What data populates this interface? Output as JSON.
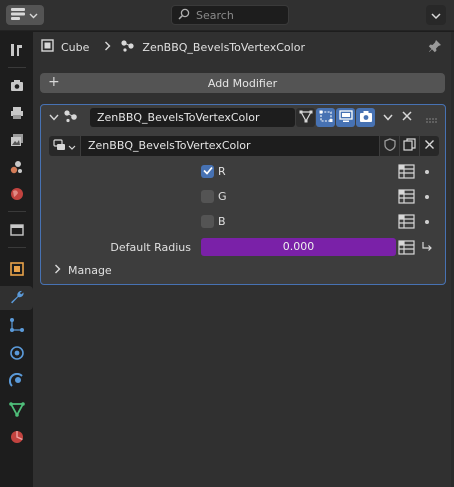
{
  "topbar": {
    "editor_icon": "properties-editor-icon",
    "search": {
      "placeholder": "Search"
    },
    "dropdown_icon": "chevron-down-icon"
  },
  "tabs": [
    {
      "name": "tool-tab",
      "icon": "tool-icon"
    },
    {
      "name": "render-tab",
      "icon": "camera-back-icon"
    },
    {
      "name": "output-tab",
      "icon": "printer-icon"
    },
    {
      "name": "view-layer-tab",
      "icon": "image-stack-icon"
    },
    {
      "name": "scene-tab",
      "icon": "scene-icon"
    },
    {
      "name": "world-tab",
      "icon": "world-icon"
    },
    {
      "name": "collection-tab",
      "icon": "collection-box-icon"
    },
    {
      "name": "object-tab",
      "icon": "object-square-icon"
    },
    {
      "name": "modifier-tab",
      "icon": "wrench-icon",
      "active": true
    },
    {
      "name": "particles-tab",
      "icon": "particles-icon"
    },
    {
      "name": "physics-tab",
      "icon": "physics-icon"
    },
    {
      "name": "constraints-tab",
      "icon": "constraint-icon"
    },
    {
      "name": "data-tab",
      "icon": "mesh-data-icon"
    },
    {
      "name": "material-tab",
      "icon": "material-icon"
    }
  ],
  "breadcrumb": {
    "object": "Cube",
    "modifier": "ZenBBQ_BevelsToVertexColor"
  },
  "add_modifier": {
    "label": "Add Modifier"
  },
  "modifier": {
    "name": "ZenBBQ_BevelsToVertexColor",
    "node_group": "ZenBBQ_BevelsToVertexColor",
    "toggles": [
      {
        "name": "on-cage-toggle",
        "icon": "vertex-triangle-icon",
        "active": false
      },
      {
        "name": "edit-mode-toggle",
        "icon": "edit-mode-icon",
        "active": true
      },
      {
        "name": "viewport-toggle",
        "icon": "monitor-icon",
        "active": true
      },
      {
        "name": "render-toggle",
        "icon": "camera-icon",
        "active": true
      }
    ],
    "inputs": [
      {
        "label": "R",
        "checked": true
      },
      {
        "label": "G",
        "checked": false
      },
      {
        "label": "B",
        "checked": false
      }
    ],
    "default_radius": {
      "label": "Default Radius",
      "value": "0.000"
    },
    "colors": {
      "accent": "#4772b3",
      "radius_field": "#7a21a8"
    },
    "manage_label": "Manage"
  }
}
